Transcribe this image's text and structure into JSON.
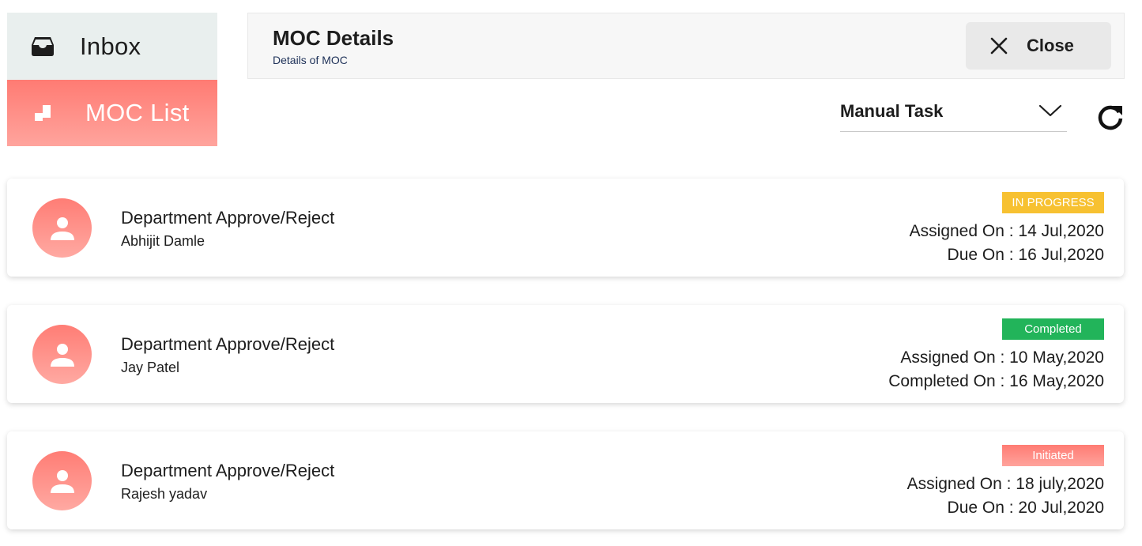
{
  "sidebar": {
    "items": [
      {
        "label": "Inbox",
        "icon": "inbox-icon",
        "active": false
      },
      {
        "label": "MOC List",
        "icon": "moc-list-icon",
        "active": true
      }
    ]
  },
  "header": {
    "title": "MOC Details",
    "subtitle": "Details of MOC",
    "close_label": "Close"
  },
  "filter": {
    "selected": "Manual Task"
  },
  "colors": {
    "accent": "#ff7b73",
    "in_progress": "#f7c131",
    "completed": "#22b45a",
    "initiated": "#ff8a82"
  },
  "tasks": [
    {
      "title": "Department Approve/Reject",
      "person": "Abhijit Damle",
      "status": "IN PROGRESS",
      "line1": "Assigned On : 14 Jul,2020",
      "line2": "Due On : 16 Jul,2020"
    },
    {
      "title": "Department Approve/Reject",
      "person": "Jay Patel",
      "status": "Completed",
      "line1": "Assigned On : 10 May,2020",
      "line2": "Completed On : 16 May,2020"
    },
    {
      "title": "Department Approve/Reject",
      "person": "Rajesh yadav",
      "status": "Initiated",
      "line1": "Assigned On : 18 july,2020",
      "line2": "Due On : 20 Jul,2020"
    }
  ]
}
